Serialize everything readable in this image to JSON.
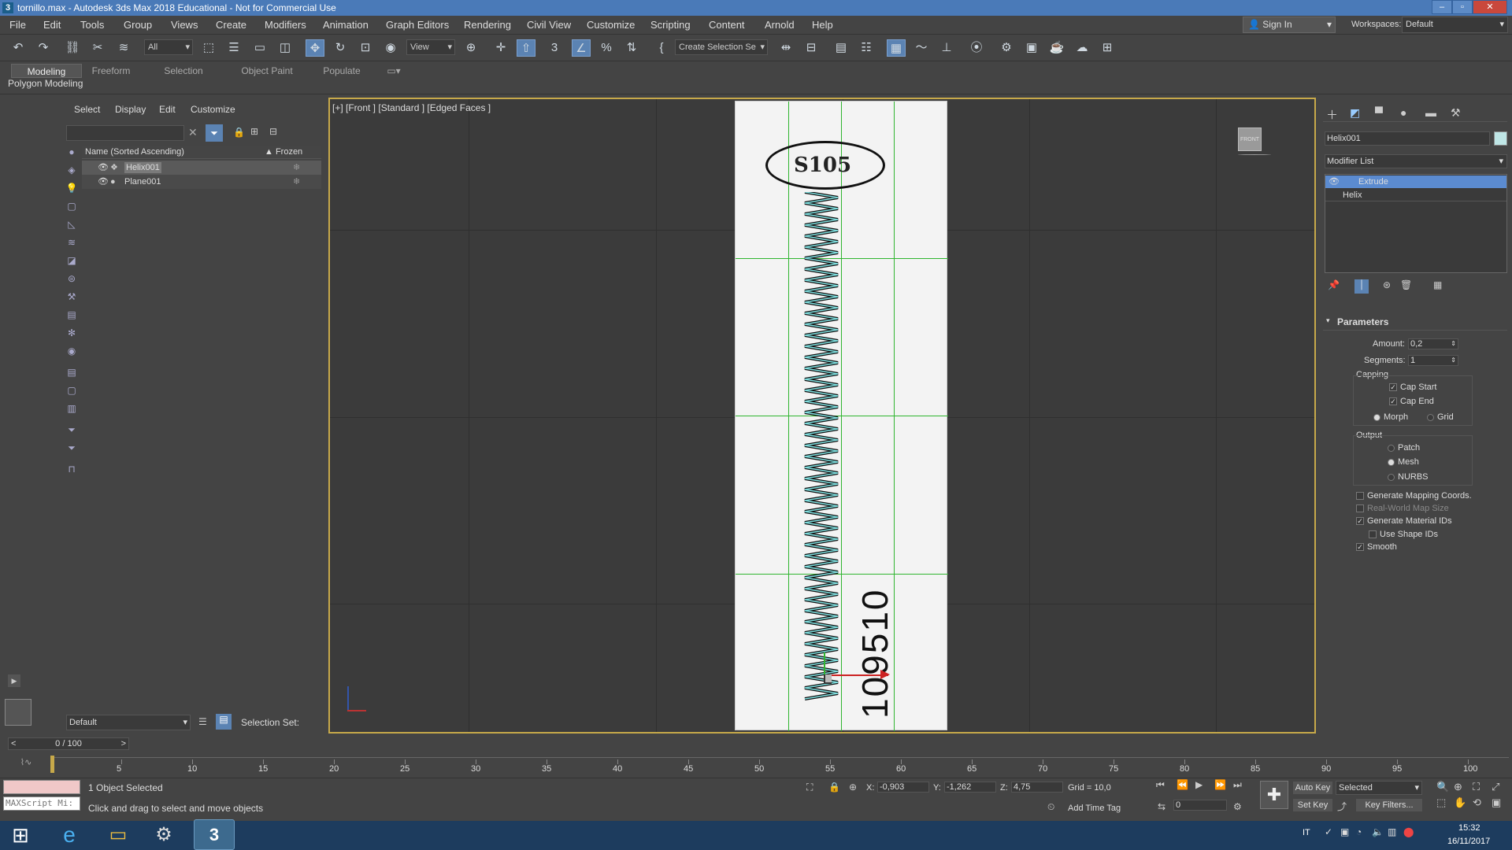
{
  "window": {
    "title": "tornillo.max - Autodesk 3ds Max 2018 Educational - Not for Commercial Use",
    "logo": "3"
  },
  "menu": [
    "File",
    "Edit",
    "Tools",
    "Group",
    "Views",
    "Create",
    "Modifiers",
    "Animation",
    "Graph Editors",
    "Rendering",
    "Civil View",
    "Customize",
    "Scripting",
    "Content",
    "Arnold",
    "Help"
  ],
  "signin": "Sign In",
  "workspaces": {
    "label": "Workspaces:",
    "value": "Default"
  },
  "toolbar": {
    "filter": "All",
    "refcoord": "View",
    "selection_set": "Create Selection Se"
  },
  "ribbon": {
    "tabs": [
      "Modeling",
      "Freeform",
      "Selection",
      "Object Paint",
      "Populate"
    ],
    "active": "Modeling",
    "panel": "Polygon Modeling"
  },
  "explorer": {
    "tabs": [
      "Select",
      "Display",
      "Edit",
      "Customize"
    ],
    "col_name": "Name (Sorted Ascending)",
    "col_frozen": "▲ Frozen",
    "rows": [
      {
        "name": "Helix001",
        "selected": true
      },
      {
        "name": "Plane001",
        "selected": false
      }
    ],
    "layer": "Default",
    "selection_set_label": "Selection Set:"
  },
  "viewport": {
    "label": "[+] [Front ] [Standard ] [Edged Faces ]",
    "viewcube": "FRONT",
    "drawing_text": "109510",
    "head_text": "S105"
  },
  "command_panel": {
    "object_name": "Helix001",
    "modifier_list": "Modifier List",
    "stack": [
      "Extrude",
      "Helix"
    ],
    "rollout": "Parameters",
    "amount_label": "Amount:",
    "amount": "0,2",
    "segments_label": "Segments:",
    "segments": "1",
    "capping_label": "Capping",
    "cap_start": "Cap Start",
    "cap_end": "Cap End",
    "morph": "Morph",
    "grid": "Grid",
    "output_label": "Output",
    "patch": "Patch",
    "mesh": "Mesh",
    "nurbs": "NURBS",
    "gen_mapping": "Generate Mapping Coords.",
    "real_world": "Real-World Map Size",
    "gen_matids": "Generate Material IDs",
    "use_shape_ids": "Use Shape IDs",
    "smooth": "Smooth"
  },
  "timeline": {
    "slider": "0 / 100",
    "ticks": [
      "5",
      "10",
      "15",
      "20",
      "25",
      "30",
      "35",
      "40",
      "45",
      "50",
      "55",
      "60",
      "65",
      "70",
      "75",
      "80",
      "85",
      "90",
      "95",
      "100"
    ]
  },
  "status": {
    "selected": "1 Object Selected",
    "prompt": "Click and drag to select and move objects",
    "maxscript": "MAXScript Mi:",
    "x_label": "X:",
    "x": "-0,903",
    "y_label": "Y:",
    "y": "-1,262",
    "z_label": "Z:",
    "z": "4,75",
    "grid": "Grid = 10,0",
    "add_time_tag": "Add Time Tag",
    "auto_key": "Auto Key",
    "set_key": "Set Key",
    "key_mode": "Selected",
    "key_filters": "Key Filters...",
    "frame": "0"
  },
  "taskbar": {
    "lang": "IT",
    "time": "15:32",
    "date": "16/11/2017"
  },
  "colors": {
    "viewport_border": "#c7a94a",
    "grid_green": "#2fb52f",
    "selection_blue": "#4a7ab8"
  }
}
